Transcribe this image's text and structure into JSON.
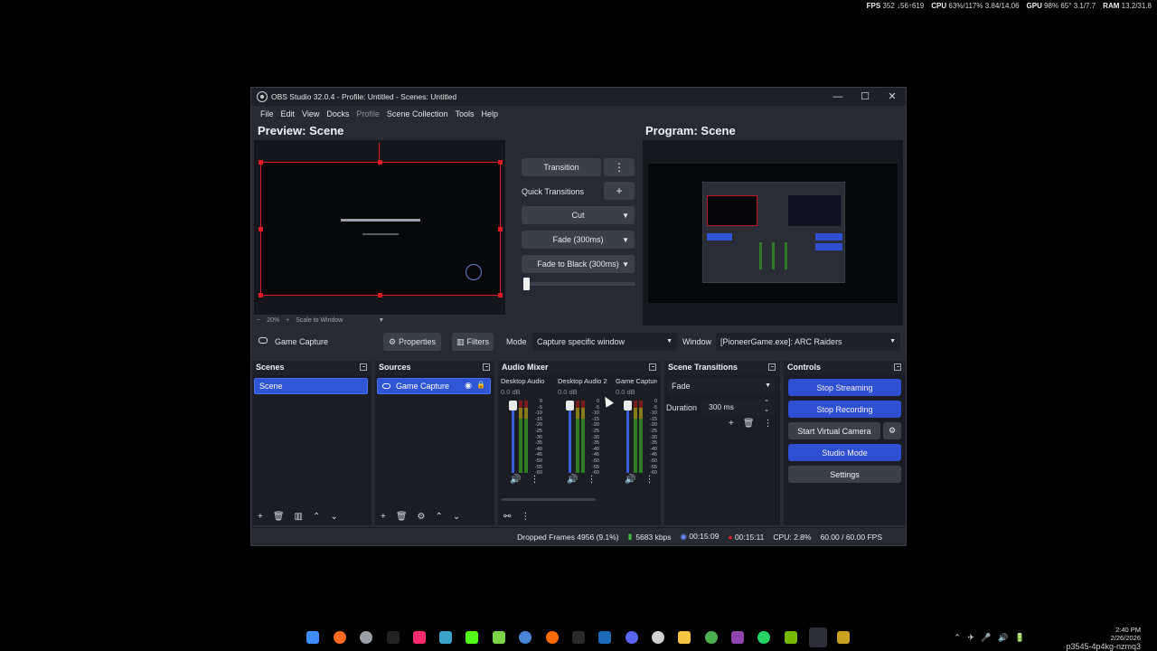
{
  "overlay": {
    "fps_label": "FPS",
    "fps": "352 ↓56↑619",
    "cpu_label": "CPU",
    "cpu": "63%/117%",
    "cpu_ghz": "3.84/14.06",
    "gpu_label": "GPU",
    "gpu": "98%",
    "gpu_temp": "65°",
    "gpu_mem": "3.1/7.7",
    "ram_label": "RAM",
    "ram": "13.2/31.8"
  },
  "window": {
    "title": "OBS Studio 32.0.4 - Profile: Untitled - Scenes: Untitled",
    "minimize": "—",
    "maximize": "☐",
    "close": "✕"
  },
  "menu": [
    "File",
    "Edit",
    "View",
    "Docks",
    "Profile",
    "Scene Collection",
    "Tools",
    "Help"
  ],
  "preview": {
    "title": "Preview: Scene",
    "zoom_minus": "−",
    "zoom": "20%",
    "zoom_plus": "+",
    "scale_mode": "Scale to Window"
  },
  "program": {
    "title": "Program: Scene"
  },
  "transitions_panel": {
    "transition_label": "Transition",
    "quick_transitions_label": "Quick Transitions",
    "cut": "Cut",
    "fade": "Fade (300ms)",
    "fade_black": "Fade to Black (300ms)"
  },
  "source_toolbar": {
    "source_name": "Game Capture",
    "properties": "Properties",
    "filters": "Filters",
    "mode_label": "Mode",
    "mode_value": "Capture specific window",
    "window_label": "Window",
    "window_value": "[PioneerGame.exe]: ARC Raiders"
  },
  "scenes": {
    "title": "Scenes",
    "items": [
      "Scene"
    ]
  },
  "sources": {
    "title": "Sources",
    "items": [
      "Game Capture"
    ]
  },
  "audio_mixer": {
    "title": "Audio Mixer",
    "channels": [
      {
        "name": "Desktop Audio",
        "db": "0.0 dB"
      },
      {
        "name": "Desktop Audio 2",
        "db": "0.0 dB"
      },
      {
        "name": "Game Capture",
        "db": "0.0 dB"
      }
    ],
    "scale": [
      "0",
      "-5",
      "-10",
      "-15",
      "-20",
      "-25",
      "-30",
      "-35",
      "-40",
      "-45",
      "-50",
      "-55",
      "-60"
    ]
  },
  "scene_transitions": {
    "title": "Scene Transitions",
    "selected": "Fade",
    "duration_label": "Duration",
    "duration_value": "300 ms"
  },
  "controls": {
    "title": "Controls",
    "stop_streaming": "Stop Streaming",
    "stop_recording": "Stop Recording",
    "start_virtual_camera": "Start Virtual Camera",
    "studio_mode": "Studio Mode",
    "settings": "Settings"
  },
  "status": {
    "dropped_frames": "Dropped Frames 4956 (9.1%)",
    "bitrate": "5683 kbps",
    "stream_time": "00:15:09",
    "record_time": "00:15:11",
    "cpu": "CPU: 2.8%",
    "fps": "60.00 / 60.00 FPS"
  },
  "tray": {
    "time": "2:40 PM",
    "date": "2/26/2026",
    "watermark": "p3545-4p4kg-nzmq3"
  },
  "colors": {
    "accent": "#2f55d4",
    "window_bg": "#272a33",
    "dock_bg": "#1b1d24",
    "preview_outline": "#e01b24"
  }
}
